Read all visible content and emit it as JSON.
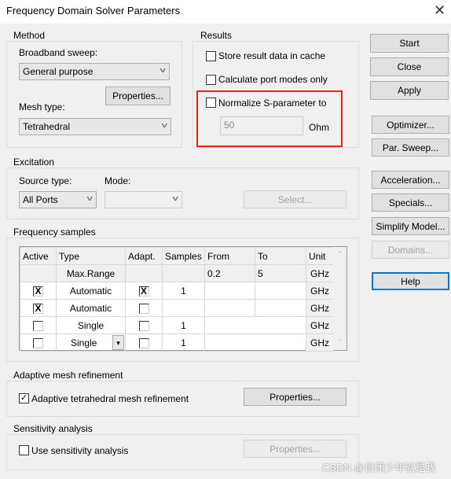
{
  "window": {
    "title": "Frequency Domain Solver Parameters",
    "close_icon": "close-icon"
  },
  "method": {
    "legend": "Method",
    "broadband_label": "Broadband sweep:",
    "broadband_value": "General purpose",
    "properties_label": "Properties...",
    "mesh_label": "Mesh type:",
    "mesh_value": "Tetrahedral"
  },
  "results": {
    "legend": "Results",
    "store_cache": {
      "label": "Store result data in cache",
      "checked": false
    },
    "port_modes": {
      "label": "Calculate port modes only",
      "checked": false
    },
    "normalize": {
      "label": "Normalize S-parameter to",
      "checked": false,
      "value": "50",
      "unit": "Ohm"
    },
    "highlight_color": "#e8231f"
  },
  "buttons": {
    "start": "Start",
    "close": "Close",
    "apply": "Apply",
    "optimizer": "Optimizer...",
    "par_sweep": "Par. Sweep...",
    "acceleration": "Acceleration...",
    "specials": "Specials...",
    "simplify": "Simplify Model...",
    "domains": "Domains...",
    "help": "Help"
  },
  "excitation": {
    "legend": "Excitation",
    "source_label": "Source type:",
    "source_value": "All Ports",
    "mode_label": "Mode:",
    "mode_value": "",
    "select_label": "Select..."
  },
  "frequency": {
    "legend": "Frequency samples",
    "columns": [
      "Active",
      "Type",
      "Adapt.",
      "Samples",
      "From",
      "To",
      "Unit"
    ],
    "rows": [
      {
        "active": "",
        "type": "Max.Range",
        "adapt": "",
        "samples": "",
        "from": "0.2",
        "to": "5",
        "unit": "GHz"
      },
      {
        "active": "X",
        "type": "Automatic",
        "adapt": "X",
        "samples": "1",
        "from": "",
        "to": "",
        "unit": "GHz"
      },
      {
        "active": "X",
        "type": "Automatic",
        "adapt": "",
        "samples": "",
        "from": "",
        "to": "",
        "unit": "GHz"
      },
      {
        "active": "",
        "type": "Single",
        "adapt": "",
        "samples": "1",
        "from": "",
        "to": "",
        "unit": "GHz"
      },
      {
        "active": "",
        "type": "Single",
        "adapt": "",
        "samples": "1",
        "from": "",
        "to": "",
        "unit": "GHz"
      }
    ]
  },
  "adaptive": {
    "legend": "Adaptive mesh refinement",
    "checkbox_label": "Adaptive tetrahedral mesh refinement",
    "checked": true,
    "properties_label": "Properties..."
  },
  "sensitivity": {
    "legend": "Sensitivity analysis",
    "checkbox_label": "Use sensitivity analysis",
    "checked": false,
    "properties_label": "Properties..."
  },
  "watermark": "CSDN @自闭少年就是我"
}
